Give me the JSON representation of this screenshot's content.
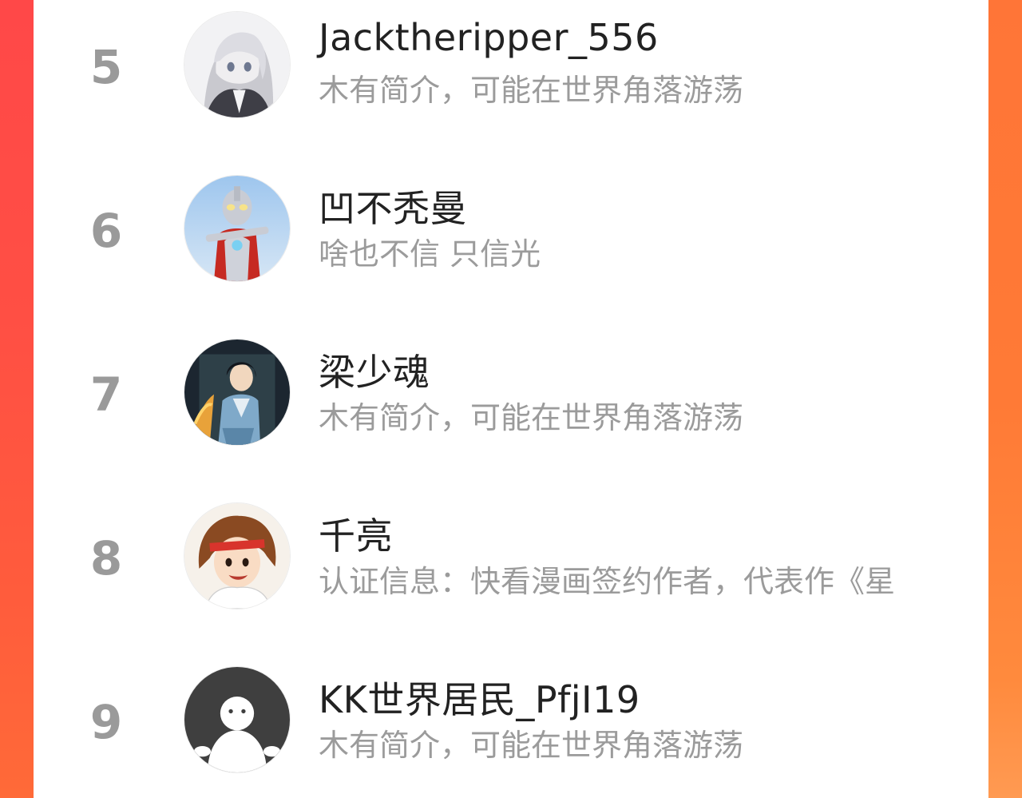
{
  "ranking": {
    "users": [
      {
        "rank": "5",
        "name": "Jacktheripper_556",
        "bio": "木有简介，可能在世界角落游荡",
        "avatar": "anime-girl-avatar"
      },
      {
        "rank": "6",
        "name": "凹不秃曼",
        "bio": "啥也不信 只信光",
        "avatar": "ultraman-avatar"
      },
      {
        "rank": "7",
        "name": "梁少魂",
        "bio": "木有简介，可能在世界角落游荡",
        "avatar": "ancient-hero-avatar"
      },
      {
        "rank": "8",
        "name": "千亮",
        "bio": "认证信息：快看漫画签约作者，代表作《星",
        "avatar": "manga-boy-avatar"
      },
      {
        "rank": "9",
        "name": "KK世界居民_PfjI19",
        "bio": "木有简介，可能在世界角落游荡",
        "avatar": "default-ghost-avatar"
      }
    ]
  },
  "colors": {
    "background_left": "#ff4848",
    "background_right": "#ff7a36",
    "rank_color": "#9a9a9a",
    "name_color": "#222222",
    "bio_color": "#9b9b9b"
  }
}
